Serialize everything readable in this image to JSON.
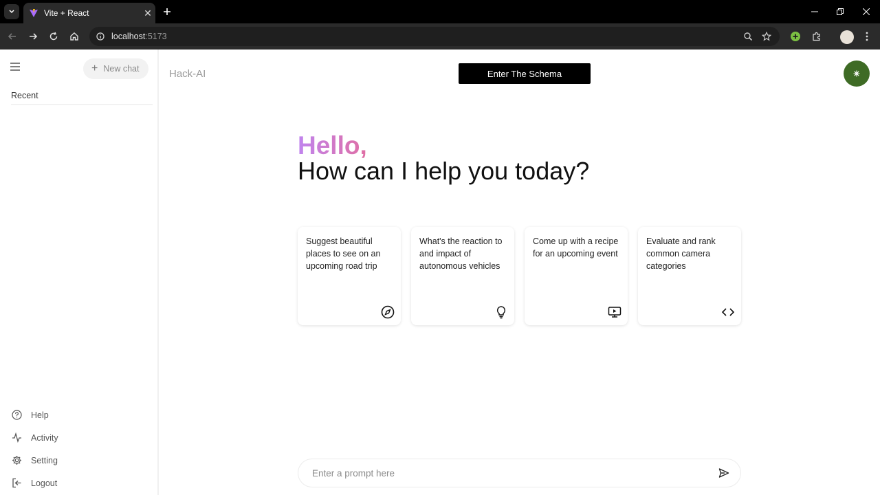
{
  "browser": {
    "tab_title": "Vite + React",
    "url_host": "localhost",
    "url_port": ":5173"
  },
  "sidebar": {
    "new_chat_label": "New chat",
    "recent_label": "Recent",
    "bottom_items": [
      {
        "label": "Help",
        "icon": "help-icon"
      },
      {
        "label": "Activity",
        "icon": "activity-icon"
      },
      {
        "label": "Setting",
        "icon": "gear-icon"
      },
      {
        "label": "Logout",
        "icon": "logout-icon"
      }
    ]
  },
  "header": {
    "app_name": "Hack-AI",
    "schema_button": "Enter The Schema",
    "avatar_color": "#3e6b25"
  },
  "greeting": {
    "hello": "Hello,",
    "subtitle": "How can I help you today?"
  },
  "cards": [
    {
      "text": "Suggest beautiful places to see on an upcoming road trip",
      "icon": "compass-icon"
    },
    {
      "text": "What's the reaction to and impact of autonomous vehicles",
      "icon": "lightbulb-icon"
    },
    {
      "text": "Come up with a recipe for an upcoming event",
      "icon": "video-icon"
    },
    {
      "text": "Evaluate and rank common camera categories",
      "icon": "code-icon"
    }
  ],
  "prompt": {
    "placeholder": "Enter a prompt here"
  }
}
